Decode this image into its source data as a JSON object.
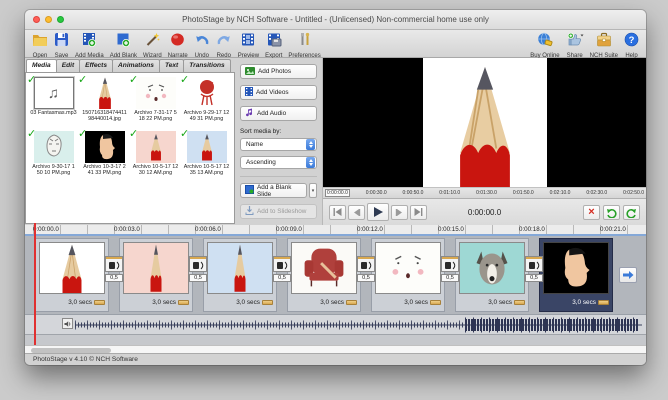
{
  "window": {
    "title": "PhotoStage by NCH Software - Untitled - (Unlicensed) Non-commercial home use only"
  },
  "toolbar": {
    "left": [
      {
        "label": "Open"
      },
      {
        "label": "Save"
      },
      {
        "label": "Add Media"
      },
      {
        "label": "Add Blank"
      },
      {
        "label": "Wizard"
      },
      {
        "label": "Narrate"
      },
      {
        "label": "Undo"
      },
      {
        "label": "Redo"
      },
      {
        "label": "Preview"
      },
      {
        "label": "Export"
      },
      {
        "label": "Preferences"
      }
    ],
    "right": [
      {
        "label": "Buy Online"
      },
      {
        "label": "Share"
      },
      {
        "label": "NCH Suite"
      },
      {
        "label": "Help"
      }
    ]
  },
  "tabs": {
    "items": [
      {
        "label": "Media"
      },
      {
        "label": "Edit"
      },
      {
        "label": "Effects"
      },
      {
        "label": "Animations"
      },
      {
        "label": "Text"
      },
      {
        "label": "Transitions"
      }
    ]
  },
  "media_panel": {
    "items": [
      {
        "name": "03 Fantasmas.mp3"
      },
      {
        "name": "150716318474411 98440014.jpg"
      },
      {
        "name": "Archivo 7-31-17 5 18 22 PM.png"
      },
      {
        "name": "Archivo 9-29-17 12 49 31 PM.png"
      },
      {
        "name": "Archivo 9-30-17 1 50 10 PM.png"
      },
      {
        "name": "Archivo 10-3-17 2 41 33 PM.png"
      },
      {
        "name": "Archivo 10-5-17 12 30 12 AM.png"
      },
      {
        "name": "Archivo 10-5-17 12 35 13 AM.png"
      }
    ]
  },
  "side_panel": {
    "add_photos": "Add Photos",
    "add_videos": "Add Videos",
    "add_audio": "Add Audio",
    "sort_label": "Sort media by:",
    "sort_field": "Name",
    "sort_order": "Ascending",
    "add_blank_slide": "Add a Blank Slide",
    "add_to_slideshow": "Add to Slideshow"
  },
  "preview": {
    "ruler_labels": [
      "0:00:00.0",
      "0:00:30.0",
      "0:00:50.0",
      "0:01:10.0",
      "0:01:30.0",
      "0:01:50.0",
      "0:02:10.0",
      "0:02:30.0",
      "0:02:50.0"
    ],
    "current_time": "0:00:00.0"
  },
  "timeline": {
    "ruler_labels": [
      "0:00:00.0",
      "0:00:03.0",
      "0:00:06.0",
      "0:00:09.0",
      "0:00:12.0",
      "0:00:15.0",
      "0:00:18.0",
      "0:00:21.0"
    ],
    "slides": [
      {
        "duration": "3,0 secs"
      },
      {
        "duration": "3,0 secs"
      },
      {
        "duration": "3,0 secs"
      },
      {
        "duration": "3,0 secs"
      },
      {
        "duration": "3,0 secs"
      },
      {
        "duration": "3,0 secs"
      },
      {
        "duration": "3,0 secs"
      }
    ],
    "transition_duration": "0,5"
  },
  "statusbar": {
    "text": "PhotoStage v 4.10 © NCH Software"
  },
  "icons": {
    "check": "✓",
    "music_note": "♫",
    "help_glyph": "?",
    "close_glyph": "×",
    "split_dot": "▾"
  },
  "colors": {
    "selection": "#3a4566",
    "check_green": "#16a616",
    "record_red": "#d42a24",
    "accent_blue": "#3a7ad8",
    "duration_button": "#d8a850"
  }
}
